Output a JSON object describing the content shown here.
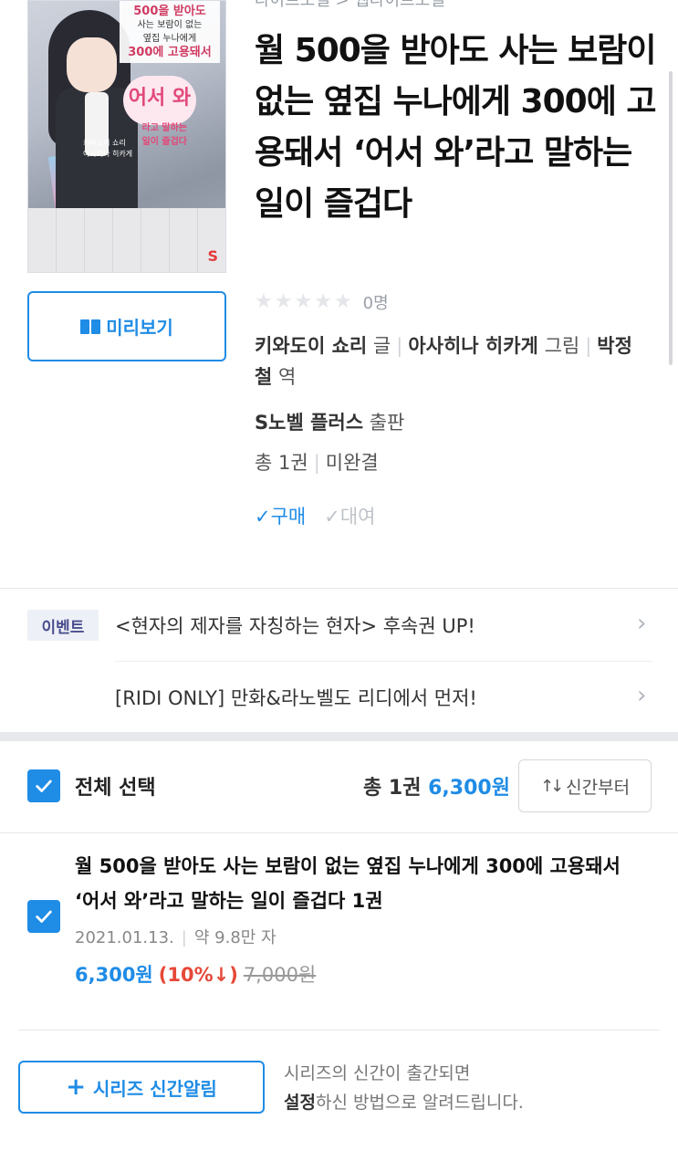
{
  "breadcrumb": "라이트노벨 > 웹라이트노벨",
  "cover": {
    "title_line1": "500을 받아도",
    "title_line2": "사는 보람이 없는",
    "title_line3": "옆집 누나에게",
    "title_line4": "300에 고용돼서",
    "welcome": "어서 와",
    "welcome_sub": "라고 말하는",
    "welcome_sub2": "일이 즐겁다",
    "author": "키와도이 쇼리",
    "illustrator": "아사히나 히카게",
    "logo": "S"
  },
  "preview_button": "미리보기",
  "book": {
    "title": "월 500을 받아도 사는 보람이 없는 옆집 누나에게 300에 고용돼서 ‘어서 와’라고 말하는 일이 즐겁다",
    "rating_count": "0명",
    "author": "키와도이 쇼리",
    "author_role": "글",
    "illustrator": "아사히나 히카게",
    "illustrator_role": "그림",
    "translator": "박정철",
    "translator_role": "역",
    "publisher": "S노벨 플러스",
    "publisher_role": "출판",
    "volumes": "총 1권",
    "status": "미완결",
    "buy_tag": "✓구매",
    "rent_tag": "✓대여"
  },
  "events": {
    "badge": "이벤트",
    "items": [
      "<현자의 제자를 자칭하는 현자> 후속권 UP!",
      "[RIDI ONLY] 만화&라노벨도 리디에서 먼저!"
    ]
  },
  "selection": {
    "select_all": "전체 선택",
    "total_count": "총 1권",
    "total_price": "6,300원",
    "sort": "신간부터"
  },
  "volume": {
    "title": "월 500을 받아도 사는 보람이 없는 옆집 누나에게 300에 고용돼서 ‘어서 와’라고 말하는 일이 즐겁다 1권",
    "date": "2021.01.13.",
    "length": "약 9.8만 자",
    "price": "6,300원",
    "discount": "(10%↓)",
    "original_price": "7,000원"
  },
  "series_alarm": {
    "button": "시리즈 신간알림",
    "desc_line1": "시리즈의 신간이 출간되면",
    "desc_bold": "설정",
    "desc_line2": "하신 방법으로 알려드립니다."
  },
  "colors": {
    "accent": "#1f8ce6",
    "discount": "#e64938",
    "badge_bg": "#eef0f7"
  }
}
